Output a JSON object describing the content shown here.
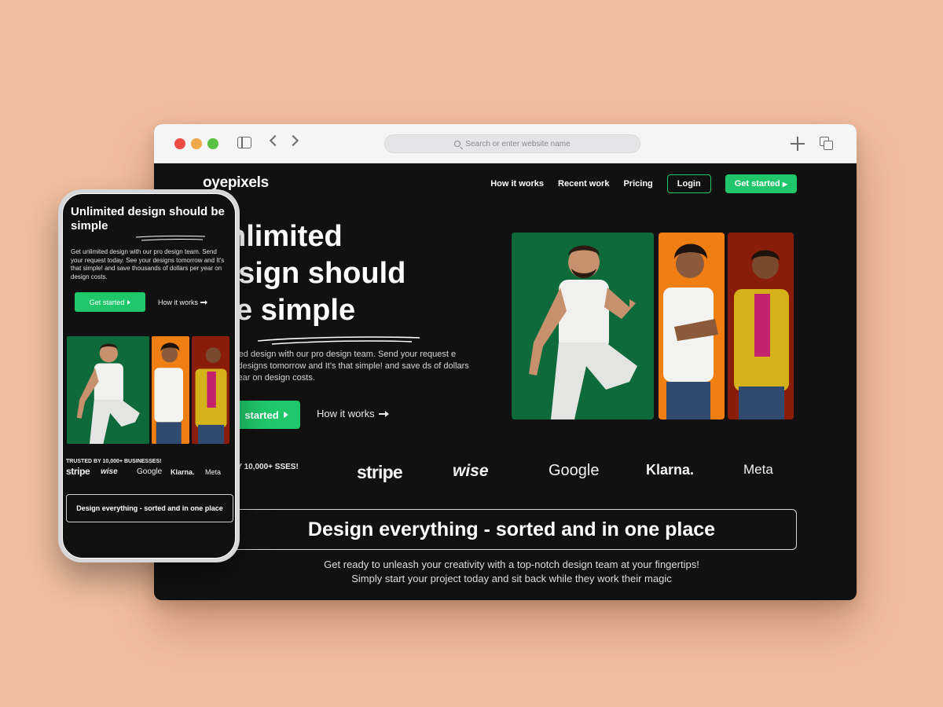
{
  "browser": {
    "address_placeholder": "Search or enter website name"
  },
  "site": {
    "logo": "oyepixels",
    "nav": {
      "how_it_works": "How it works",
      "recent_work": "Recent work",
      "pricing": "Pricing",
      "login": "Login",
      "get_started": "Get started"
    },
    "hero": {
      "title_line1": "nlimited",
      "title_line2": "esign should",
      "title_line3": "e simple",
      "desc": "nlimited design with our pro design team. Send your request e your designs tomorrow and It's that simple! and save ds of dollars per year on design costs.",
      "cta": "started",
      "how": "How it works"
    },
    "trusted": ") BY 10,000+ SSES!",
    "brands": [
      "stripe",
      "wise",
      "Google",
      "Klarna.",
      "Meta"
    ],
    "sorted_title": "Design everything - sorted and in one place",
    "sub_line1": "Get ready to unleash your creativity with a top-notch design team at your fingertips!",
    "sub_line2": "Simply start your project today and sit back while they work their magic"
  },
  "phone": {
    "title": "Unlimited design should be simple",
    "desc": "Get unlimited design with our pro design team. Send your request today. See your designs tomorrow and It's that simple! and save thousands of dollars per year on design costs.",
    "cta": "Get started",
    "how": "How it works",
    "trusted": "TRUSTED BY 10,000+ BUSINESSES!",
    "brands": [
      "stripe",
      "wise",
      "Google",
      "Klarna.",
      "Meta"
    ],
    "sorted_title": "Design everything - sorted and in one place"
  },
  "colors": {
    "background": "#f1be9f",
    "accent_green": "#1fc76a",
    "photo_green": "#0e6a3b",
    "photo_orange": "#ef7f12",
    "photo_red": "#8a1d0a",
    "dark": "#111112"
  }
}
